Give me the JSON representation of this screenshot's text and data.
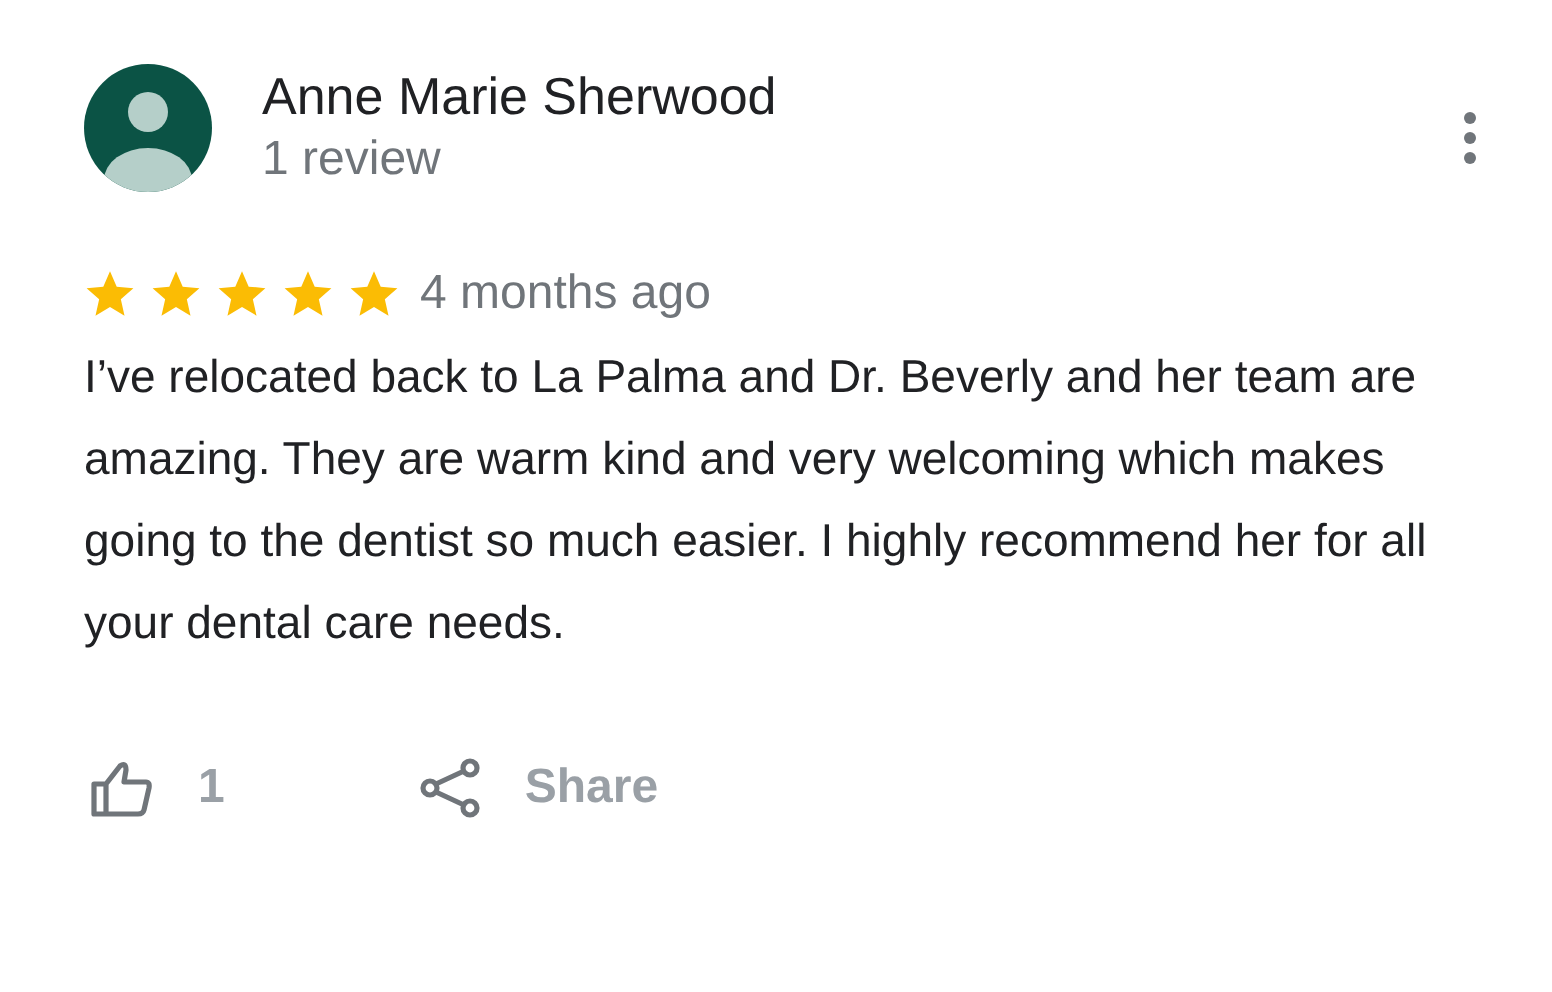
{
  "reviewer": {
    "name": "Anne Marie Sherwood",
    "review_count": "1 review"
  },
  "review": {
    "stars": 5,
    "time": "4 months ago",
    "text": "I’ve relocated back to La Palma and Dr. Beverly and her team are amazing.  They are warm kind and very welcoming which makes going to the dentist so much easier.  I highly recommend her for all your dental care needs."
  },
  "actions": {
    "likes": "1",
    "share": "Share"
  }
}
